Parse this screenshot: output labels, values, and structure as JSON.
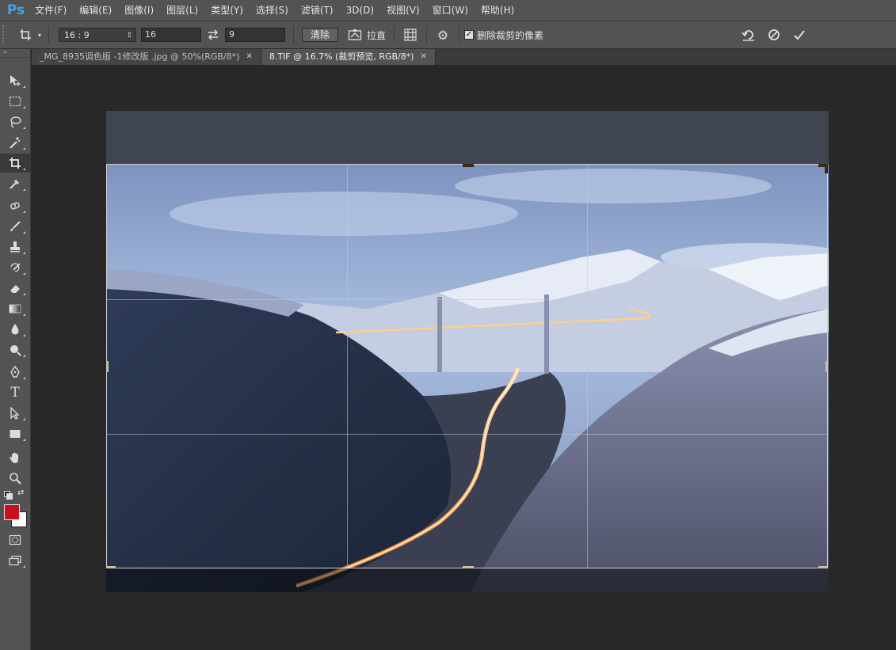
{
  "app": {
    "logo": "Ps"
  },
  "menu": [
    "文件(F)",
    "编辑(E)",
    "图像(I)",
    "图层(L)",
    "类型(Y)",
    "选择(S)",
    "滤镜(T)",
    "3D(D)",
    "视图(V)",
    "窗口(W)",
    "帮助(H)"
  ],
  "options": {
    "tool_icon": "crop-icon",
    "ratio_value": "16 : 9",
    "width_value": "16",
    "height_value": "9",
    "swap_icon": "swap-arrows-icon",
    "clear_label": "清除",
    "straighten_label": "拉直",
    "overlay_icon": "grid-icon",
    "settings_icon": "gear-icon",
    "delete_pixels_label": "删除裁剪的像素",
    "delete_pixels_checked": true,
    "reset_icon": "reset-icon",
    "cancel_icon": "cancel-icon",
    "commit_icon": "check-icon"
  },
  "tabs": [
    {
      "label": "_MG_8935调色版 -1修改版 .jpg @ 50%(RGB/8*)",
      "active": false
    },
    {
      "label": "8.TIF @ 16.7% (裁剪预览, RGB/8*)",
      "active": true
    }
  ],
  "tools": [
    "move-icon",
    "marquee-icon",
    "lasso-icon",
    "magic-wand-icon",
    "crop-icon",
    "eyedropper-icon",
    "healing-brush-icon",
    "brush-icon",
    "stamp-icon",
    "history-brush-icon",
    "eraser-icon",
    "gradient-icon",
    "blur-icon",
    "dodge-icon",
    "pen-icon",
    "type-icon",
    "path-select-icon",
    "rectangle-icon",
    "hand-icon",
    "zoom-icon"
  ],
  "type_tool_label": "T",
  "colors": {
    "foreground": "#c8101e",
    "background": "#ffffff",
    "accent": "#4ca0e0"
  }
}
